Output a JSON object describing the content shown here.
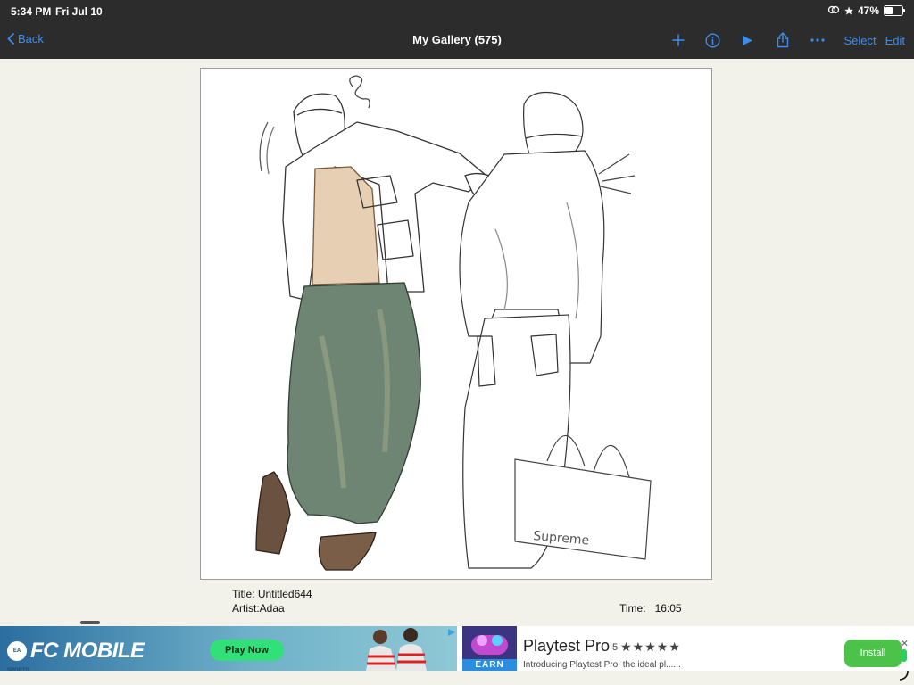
{
  "status_bar": {
    "time": "5:34 PM",
    "date": "Fri Jul 10",
    "battery_percent": "47%",
    "battery_level": 0.47,
    "icons": [
      "screen-mirroring-icon",
      "star-icon",
      "battery-icon"
    ]
  },
  "nav": {
    "back_label": "Back",
    "title": "My Gallery (575)",
    "select_label": "Select",
    "edit_label": "Edit",
    "icons": [
      "plus-icon",
      "info-icon",
      "play-icon",
      "share-icon",
      "more-icon"
    ],
    "accent_color": "#3a8ef0"
  },
  "artwork": {
    "title_line": "Title: Untitled644",
    "artist_line": "Artist:Adaa",
    "time_label": "Time:",
    "time_value": "16:05",
    "bag_text": "Supreme"
  },
  "ad_left": {
    "brand_badge": "EA SPORTS",
    "game_title": "FC MOBILE",
    "cta_label": "Play Now",
    "cta_color": "#32e07a"
  },
  "ad_right": {
    "icon_badge": "EARN",
    "app_name": "Playtest Pro",
    "rating_value": "5",
    "stars": "★★★★★",
    "rating": 5,
    "description": "Introducing Playtest Pro, the ideal pl......",
    "install_label": "Install",
    "install_color": "#4cc24a",
    "close_glyph": "✕"
  }
}
